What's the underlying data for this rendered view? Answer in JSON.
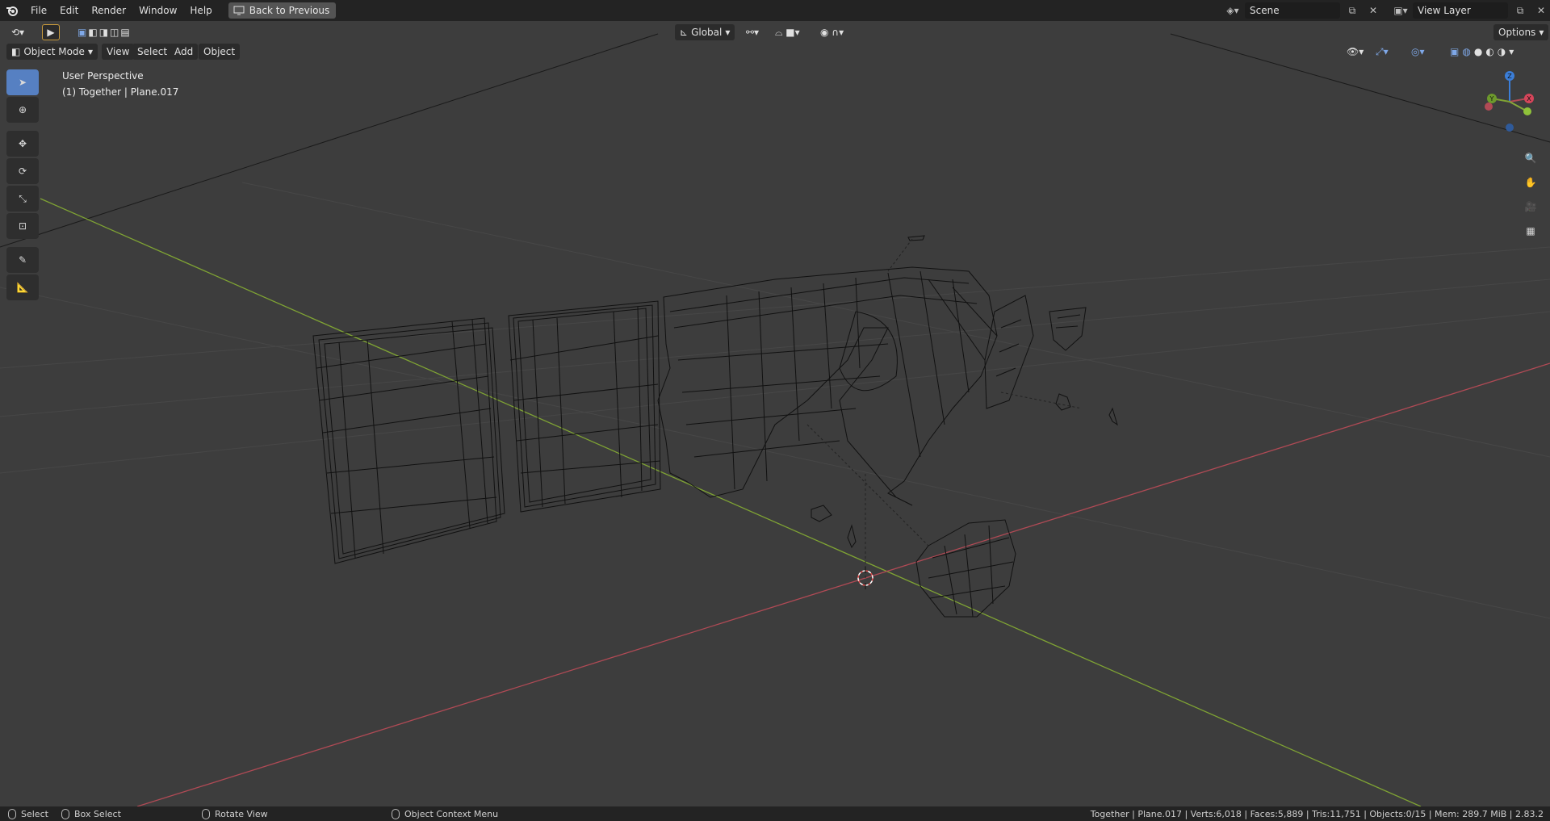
{
  "topbar": {
    "menus": [
      "File",
      "Edit",
      "Render",
      "Window",
      "Help"
    ],
    "back_button": "Back to Previous",
    "scene": "Scene",
    "view_layer": "View Layer"
  },
  "viewport_header": {
    "mode": "Object Mode",
    "menus": [
      "View",
      "Select",
      "Add",
      "Object"
    ],
    "orientation": "Global",
    "options": "Options"
  },
  "overlay": {
    "perspective": "User Perspective",
    "object_info": "(1) Together | Plane.017"
  },
  "gizmo": {
    "x_label": "X",
    "y_label": "Y",
    "z_label": "Z"
  },
  "statusbar": {
    "select": "Select",
    "box_select": "Box Select",
    "rotate_view": "Rotate View",
    "context_menu": "Object Context Menu",
    "stats": "Together | Plane.017 | Verts:6,018 | Faces:5,889 | Tris:11,751 | Objects:0/15 | Mem: 289.7 MiB | 2.83.2"
  },
  "colors": {
    "background": "#3d3d3d",
    "active_tool": "#5680c2",
    "x_axis": "#b04a55",
    "y_axis": "#7fa334",
    "wire": "#111111"
  }
}
